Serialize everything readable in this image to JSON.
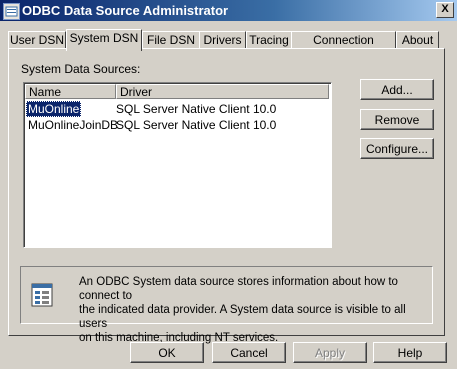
{
  "window": {
    "title": "ODBC Data Source Administrator",
    "close_label": "X"
  },
  "tabs": [
    {
      "label": "User DSN",
      "active": false
    },
    {
      "label": "System DSN",
      "active": true
    },
    {
      "label": "File DSN",
      "active": false
    },
    {
      "label": "Drivers",
      "active": false
    },
    {
      "label": "Tracing",
      "active": false
    },
    {
      "label": "Connection Pooling",
      "active": false
    },
    {
      "label": "About",
      "active": false
    }
  ],
  "system_dsn": {
    "label": "System Data Sources:",
    "columns": [
      "Name",
      "Driver"
    ],
    "rows": [
      {
        "name": "MuOnline",
        "driver": "SQL Server Native Client 10.0",
        "selected": true
      },
      {
        "name": "MuOnlineJoinDB",
        "driver": "SQL Server Native Client 10.0",
        "selected": false
      }
    ],
    "buttons": {
      "add": "Add...",
      "remove": "Remove",
      "configure": "Configure..."
    },
    "info": {
      "line1": "An ODBC System data source stores information about how to connect to",
      "line2": "the indicated data provider.   A System data source is visible to all users",
      "line3": "on this machine, including NT services."
    }
  },
  "footer": {
    "ok": "OK",
    "cancel": "Cancel",
    "apply": "Apply",
    "help": "Help"
  }
}
